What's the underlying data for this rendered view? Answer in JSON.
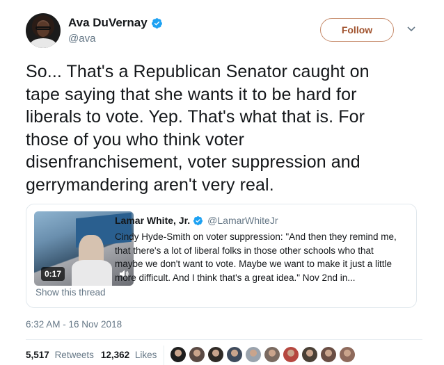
{
  "author": {
    "display_name": "Ava DuVernay",
    "handle": "@ava",
    "verified": true
  },
  "follow_button": {
    "label": "Follow"
  },
  "tweet": {
    "lines": [
      "So... That's a Republican Senator caught on",
      "tape saying that she wants it to be hard for",
      "liberals to vote. Yep. That's what that is. For",
      "those of you who think voter",
      "disenfranchisement, voter suppression and",
      "gerrymandering aren't very real."
    ]
  },
  "quoted": {
    "name": "Lamar White, Jr.",
    "handle": "@LamarWhiteJr",
    "verified": true,
    "video_duration": "0:17",
    "lines": [
      "Cindy Hyde-Smith on voter suppression: \"And then they remind me,",
      "that there's a lot of liberal folks in those other schools who that",
      "maybe we don't want to vote. Maybe we want to make it just a little",
      "more difficult. And I think that's a great idea.\" Nov 2nd in..."
    ],
    "show_thread": "Show this thread"
  },
  "timestamp": "6:32 AM - 16 Nov 2018",
  "stats": {
    "retweets_count": "5,517",
    "retweets_label": "Retweets",
    "likes_count": "12,362",
    "likes_label": "Likes"
  },
  "colors": {
    "follow_accent": "#a0522d",
    "verified": "#1da1f2",
    "muted_text": "#657786",
    "primary_text": "#14171a"
  },
  "liker_avatars": [
    {
      "icon": "user-avatar-1",
      "color": "#1e1e1e"
    },
    {
      "icon": "user-avatar-2",
      "color": "#5a4a44"
    },
    {
      "icon": "user-avatar-3",
      "color": "#2f2a26"
    },
    {
      "icon": "user-avatar-4",
      "color": "#3e4a5c"
    },
    {
      "icon": "user-avatar-5",
      "color": "#9aa3ad"
    },
    {
      "icon": "user-avatar-6",
      "color": "#7a6a60"
    },
    {
      "icon": "user-avatar-7",
      "color": "#b5473f"
    },
    {
      "icon": "user-avatar-8",
      "color": "#4a4036"
    },
    {
      "icon": "user-avatar-9",
      "color": "#6a4e44"
    },
    {
      "icon": "user-avatar-10",
      "color": "#8e6a5c"
    }
  ]
}
